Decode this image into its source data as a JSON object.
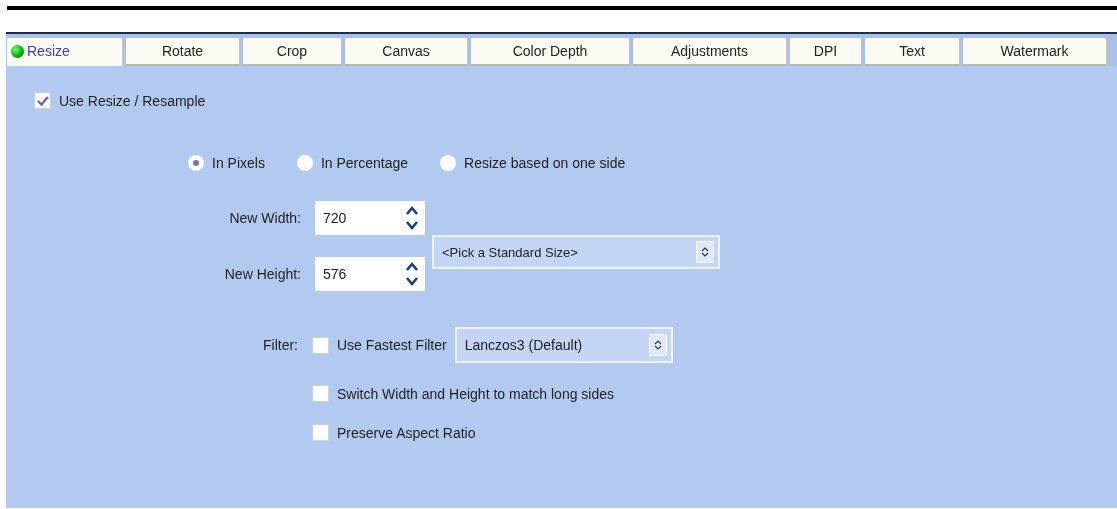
{
  "tabs": [
    {
      "label": "Resize",
      "selected": true
    },
    {
      "label": "Rotate",
      "selected": false
    },
    {
      "label": "Crop",
      "selected": false
    },
    {
      "label": "Canvas",
      "selected": false
    },
    {
      "label": "Color Depth",
      "selected": false
    },
    {
      "label": "Adjustments",
      "selected": false
    },
    {
      "label": "DPI",
      "selected": false
    },
    {
      "label": "Text",
      "selected": false
    },
    {
      "label": "Watermark",
      "selected": false
    }
  ],
  "use_resize": {
    "label": "Use Resize / Resample",
    "checked": true
  },
  "mode_options": [
    {
      "label": "In Pixels",
      "selected": true
    },
    {
      "label": "In Percentage",
      "selected": false
    },
    {
      "label": "Resize based on one side",
      "selected": false
    }
  ],
  "new_width": {
    "label": "New Width:",
    "value": "720"
  },
  "new_height": {
    "label": "New Height:",
    "value": "576"
  },
  "standard_size": {
    "value": "<Pick a Standard Size>"
  },
  "filter": {
    "label": "Filter:",
    "fastest": {
      "label": "Use Fastest Filter",
      "checked": false
    },
    "value": "Lanczos3 (Default)"
  },
  "options": [
    {
      "label": "Switch Width and Height to match long sides",
      "checked": false
    },
    {
      "label": "Preserve Aspect Ratio",
      "checked": false
    }
  ]
}
